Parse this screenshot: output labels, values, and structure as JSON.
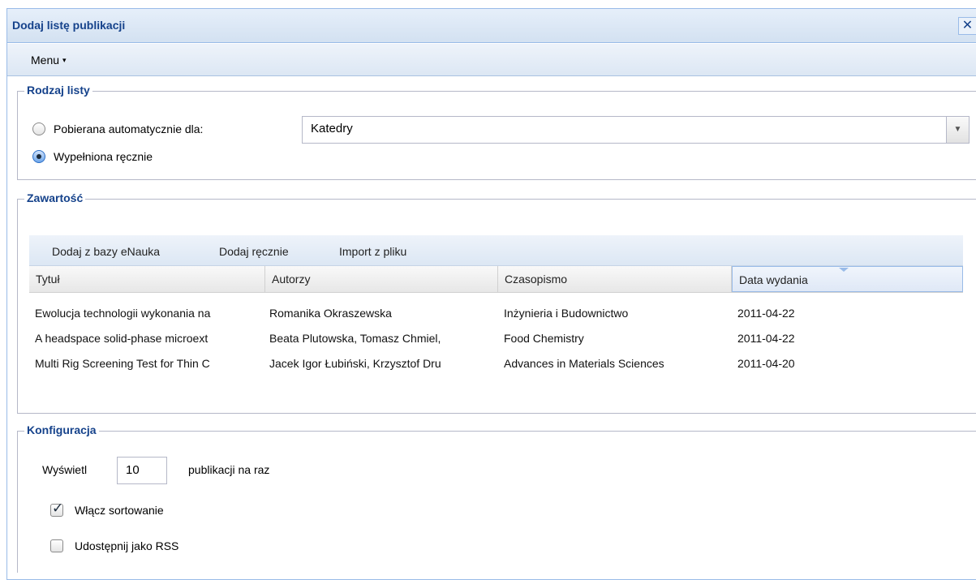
{
  "window": {
    "title": "Dodaj listę publikacji",
    "close_glyph": "✕",
    "close_icon": "close-icon"
  },
  "menu": {
    "label": "Menu",
    "arrow_glyph": "▾"
  },
  "list_type": {
    "legend": "Rodzaj listy",
    "options": [
      {
        "label": "Pobierana automatycznie dla:",
        "checked": false
      },
      {
        "label": "Wypełniona ręcznie",
        "checked": true
      }
    ],
    "combo_value": "Katedry",
    "combo_trigger_glyph": "▼"
  },
  "content": {
    "legend": "Zawartość",
    "toolbar": [
      "Dodaj z bazy eNauka",
      "Dodaj ręcznie",
      "Import z pliku"
    ],
    "columns": [
      "Tytuł",
      "Autorzy",
      "Czasopismo",
      "Data wydania"
    ],
    "sorted_column": "Data wydania",
    "rows": [
      [
        "Ewolucja technologii wykonania na",
        "Romanika Okraszewska",
        "Inżynieria i Budownictwo",
        "2011-04-22"
      ],
      [
        "A headspace solid-phase microext",
        "Beata Plutowska, Tomasz Chmiel,",
        "Food Chemistry",
        "2011-04-22"
      ],
      [
        "Multi Rig Screening Test for Thin C",
        "Jacek Igor Łubiński, Krzysztof Dru",
        "Advances in Materials Sciences",
        "2011-04-20"
      ]
    ]
  },
  "config": {
    "legend": "Konfiguracja",
    "show_label": "Wyświetl",
    "per_page": "10",
    "per_page_suffix": "publikacji na raz",
    "sorting_label": "Włącz sortowanie",
    "sorting_checked": true,
    "rss_label": "Udostępnij jako RSS",
    "rss_checked": false
  },
  "colors": {
    "accent": "#15428b",
    "frame": "#99bbe8"
  }
}
